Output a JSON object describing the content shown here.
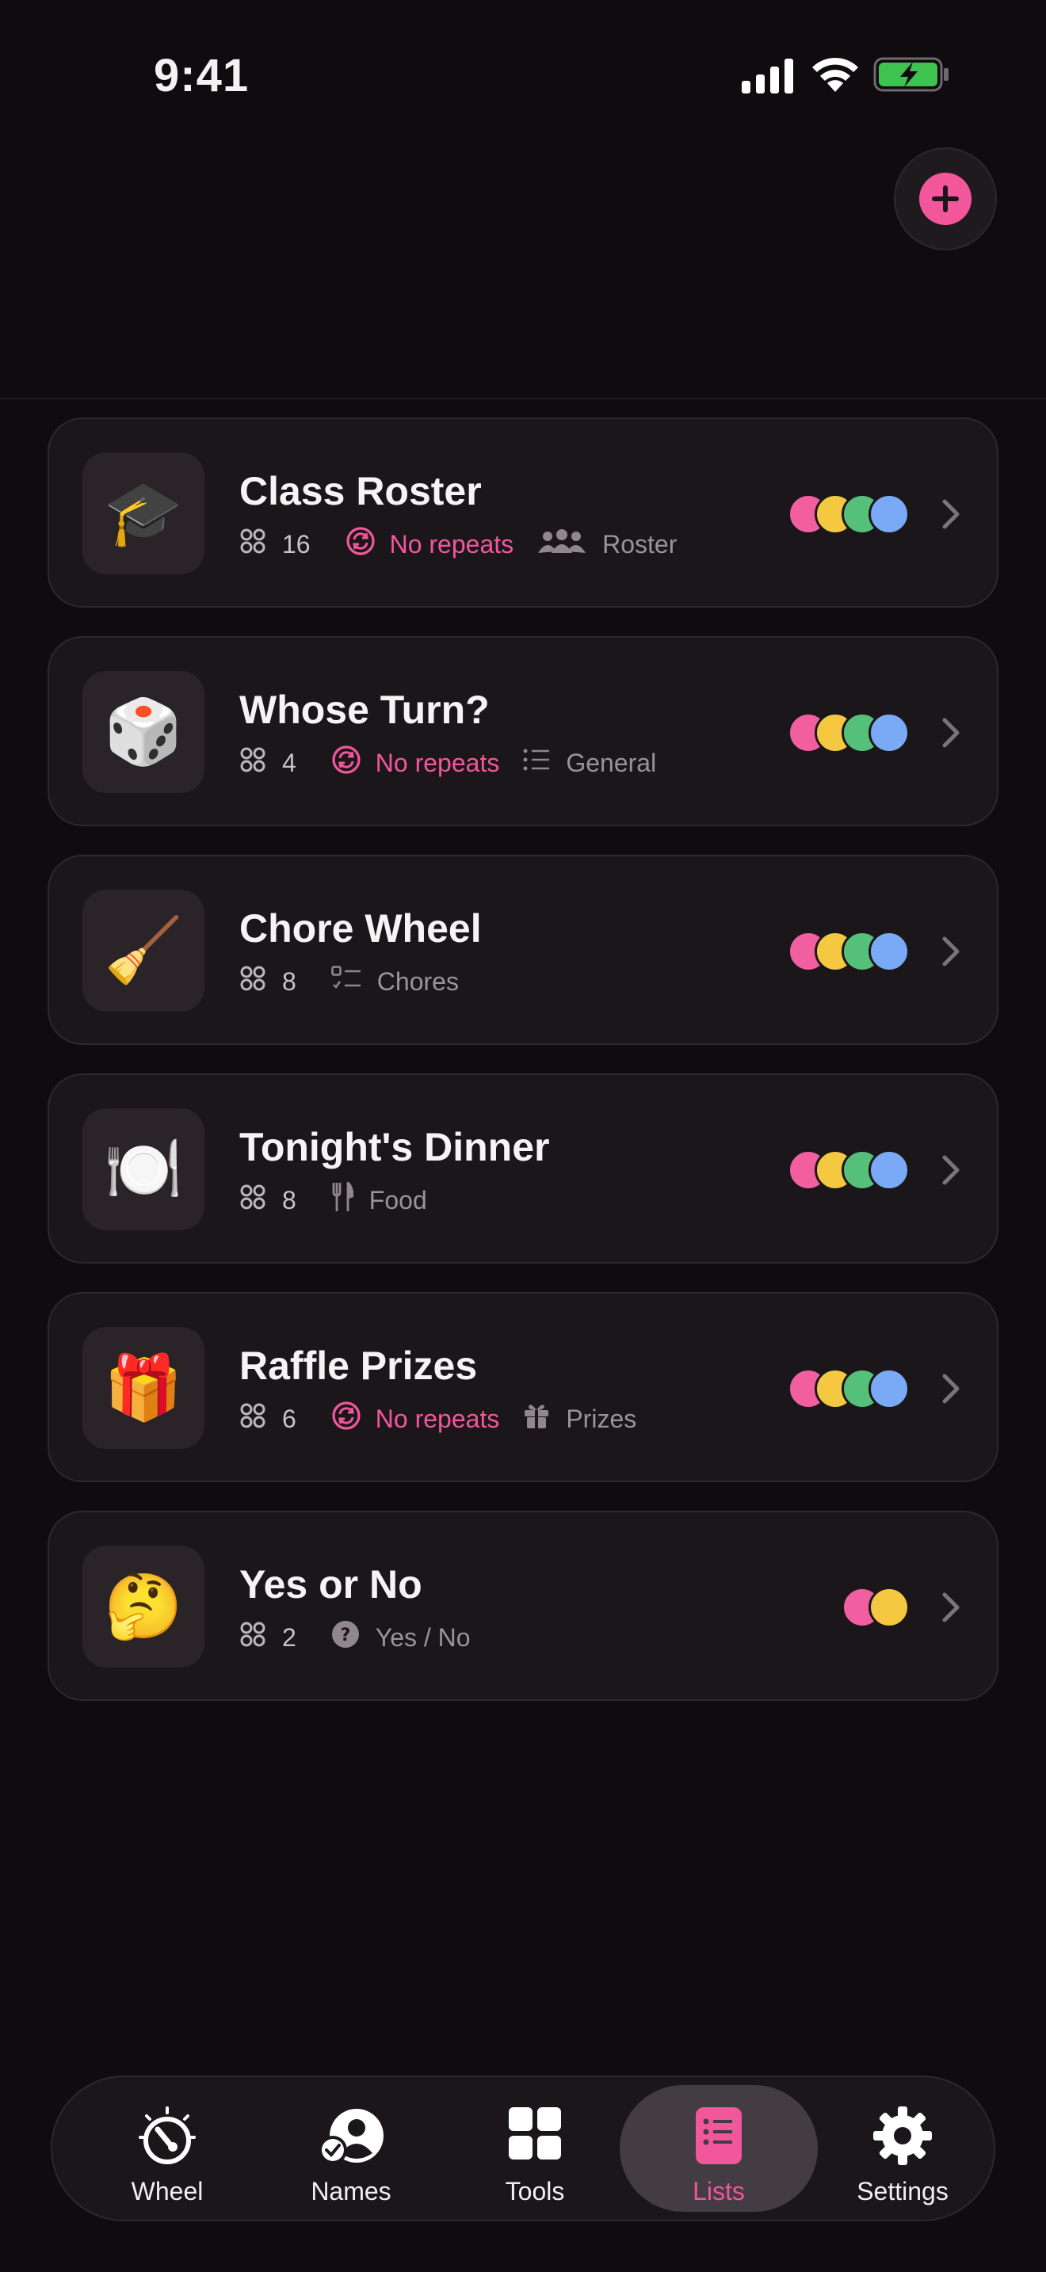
{
  "status_bar": {
    "time": "9:41"
  },
  "colors": {
    "accent": "#f2579b",
    "pink": "#f25fa0",
    "yellow": "#f5c842",
    "green": "#55c07a",
    "blue": "#7aaaf5"
  },
  "lists": [
    {
      "emoji": "🎓",
      "icon": "graduation-cap-icon",
      "title": "Class Roster",
      "count": "16",
      "repeat": "No repeats",
      "category_icon": "people-icon",
      "category": "Roster",
      "dot_count": 4
    },
    {
      "emoji": "🎲",
      "icon": "dice-icon",
      "title": "Whose Turn?",
      "count": "4",
      "repeat": "No repeats",
      "category_icon": "list-icon",
      "category": "General",
      "dot_count": 4
    },
    {
      "emoji": "🧹",
      "icon": "broom-icon",
      "title": "Chore Wheel",
      "count": "8",
      "repeat": "",
      "category_icon": "checklist-icon",
      "category": "Chores",
      "dot_count": 4
    },
    {
      "emoji": "🍽️",
      "icon": "plate-icon",
      "title": "Tonight's Dinner",
      "count": "8",
      "repeat": "",
      "category_icon": "fork-knife-icon",
      "category": "Food",
      "dot_count": 4
    },
    {
      "emoji": "🎁",
      "icon": "gift-emoji-icon",
      "title": "Raffle Prizes",
      "count": "6",
      "repeat": "No repeats",
      "category_icon": "gift-icon",
      "category": "Prizes",
      "dot_count": 4
    },
    {
      "emoji": "🤔",
      "icon": "thinking-face-icon",
      "title": "Yes or No",
      "count": "2",
      "repeat": "",
      "category_icon": "question-icon",
      "category": "Yes / No",
      "dot_count": 2
    }
  ],
  "tabs": [
    {
      "label": "Wheel",
      "icon": "wheel-icon",
      "active": false
    },
    {
      "label": "Names",
      "icon": "names-icon",
      "active": false
    },
    {
      "label": "Tools",
      "icon": "tools-grid-icon",
      "active": false
    },
    {
      "label": "Lists",
      "icon": "lists-icon",
      "active": true
    },
    {
      "label": "Settings",
      "icon": "gear-icon",
      "active": false
    }
  ]
}
